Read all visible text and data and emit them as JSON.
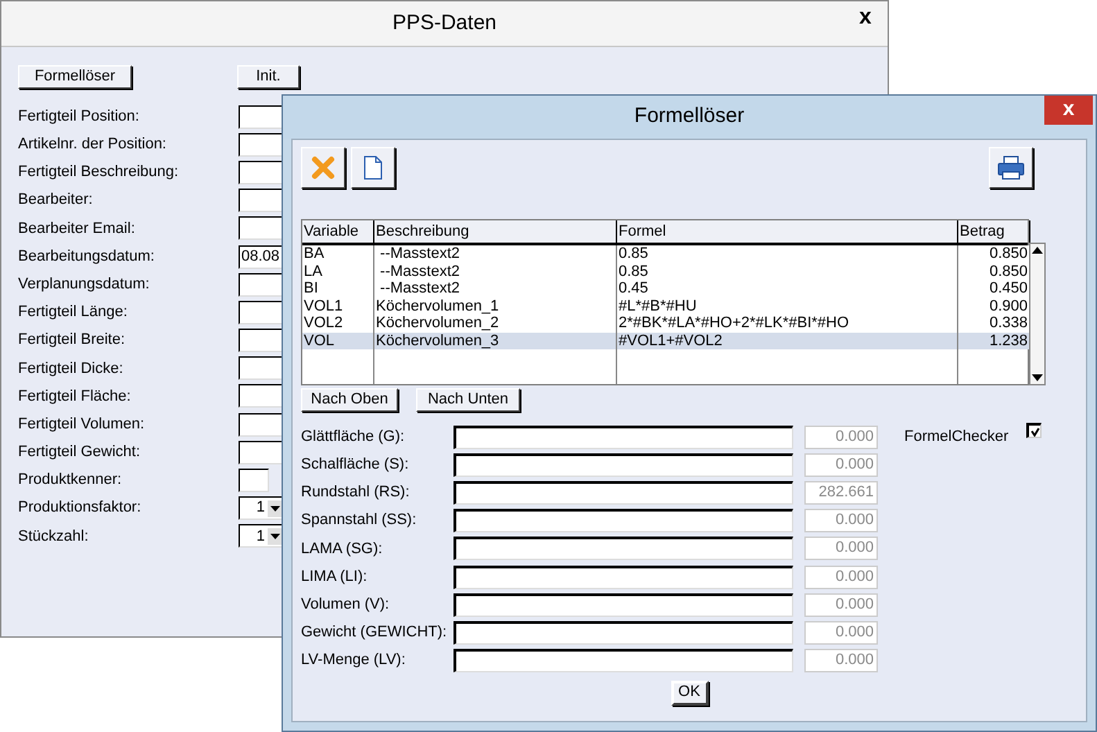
{
  "main_window": {
    "title": "PPS-Daten",
    "close": "x",
    "buttons": [
      "Formellöser",
      "Init."
    ],
    "fields": [
      {
        "label": "Fertigteil Position:",
        "kind": "text"
      },
      {
        "label": "Artikelnr. der Position:",
        "kind": "text"
      },
      {
        "label": "Fertigteil Beschreibung:",
        "kind": "text"
      },
      {
        "label": "Bearbeiter:",
        "kind": "text"
      },
      {
        "label": "Bearbeiter Email:",
        "kind": "text"
      },
      {
        "label": "Bearbeitungsdatum:",
        "kind": "text",
        "value": "08.08"
      },
      {
        "label": "Verplanungsdatum:",
        "kind": "text"
      },
      {
        "label": "Fertigteil Länge:",
        "kind": "text"
      },
      {
        "label": "Fertigteil Breite:",
        "kind": "text"
      },
      {
        "label": "Fertigteil Dicke:",
        "kind": "text"
      },
      {
        "label": "Fertigteil Fläche:",
        "kind": "text"
      },
      {
        "label": "Fertigteil Volumen:",
        "kind": "text"
      },
      {
        "label": "Fertigteil Gewicht:",
        "kind": "text"
      },
      {
        "label": "Produktkenner:",
        "kind": "short"
      },
      {
        "label": "Produktionsfaktor:",
        "kind": "combo",
        "value": "1"
      },
      {
        "label": "Stückzahl:",
        "kind": "combo",
        "value": "1"
      }
    ]
  },
  "dialog": {
    "title": "Formellöser",
    "close": "x",
    "table": {
      "columns": [
        "Variable",
        "Beschreibung",
        "Formel",
        "Betrag"
      ],
      "rows": [
        {
          "cells": [
            "BA",
            " --Masstext2",
            "0.85",
            "0.850"
          ],
          "selected": false
        },
        {
          "cells": [
            "LA",
            " --Masstext2",
            "0.85",
            "0.850"
          ],
          "selected": false
        },
        {
          "cells": [
            "BI",
            " --Masstext2",
            "0.45",
            "0.450"
          ],
          "selected": false
        },
        {
          "cells": [
            "VOL1",
            "Köchervolumen_1",
            "#L*#B*#HU",
            "0.900"
          ],
          "selected": false
        },
        {
          "cells": [
            "VOL2",
            "Köchervolumen_2",
            "2*#BK*#LA*#HO+2*#LK*#BI*#HO",
            "0.338"
          ],
          "selected": false
        },
        {
          "cells": [
            "VOL",
            "Köchervolumen_3",
            "#VOL1+#VOL2",
            "1.238"
          ],
          "selected": true
        }
      ]
    },
    "move_buttons": [
      "Nach Oben",
      "Nach Unten"
    ],
    "results": [
      {
        "label": "Glättfläche (G):",
        "value": "0.000"
      },
      {
        "label": "Schalfläche (S):",
        "value": "0.000"
      },
      {
        "label": "Rundstahl (RS):",
        "value": "282.661"
      },
      {
        "label": "Spannstahl (SS):",
        "value": "0.000"
      },
      {
        "label": "LAMA (SG):",
        "value": "0.000"
      },
      {
        "label": "LIMA (LI):",
        "value": "0.000"
      },
      {
        "label": "Volumen (V):",
        "value": "0.000"
      },
      {
        "label": "Gewicht (GEWICHT):",
        "value": "0.000"
      },
      {
        "label": "LV-Menge (LV):",
        "value": "0.000"
      }
    ],
    "checker": {
      "label": "FormelChecker",
      "checked": true
    },
    "ok": "OK"
  }
}
